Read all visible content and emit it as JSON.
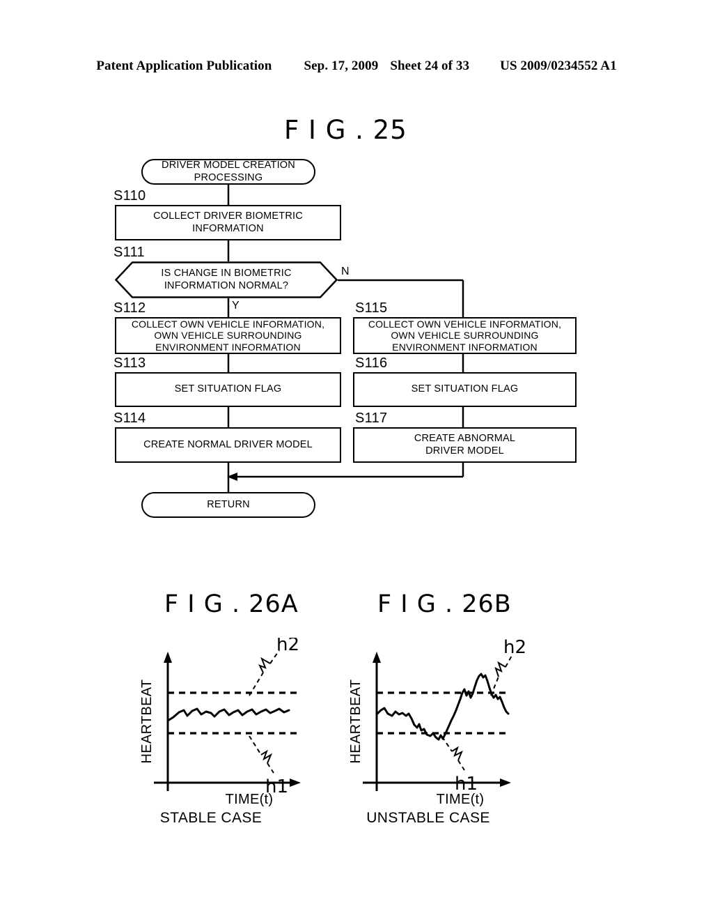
{
  "header": {
    "publication": "Patent Application Publication",
    "date": "Sep. 17, 2009",
    "sheet": "Sheet 24 of 33",
    "patent_number": "US 2009/0234552 A1"
  },
  "figures": {
    "fig25": {
      "title": "F I G . 25",
      "nodes": {
        "start": "DRIVER MODEL CREATION\nPROCESSING",
        "s110_box": "COLLECT DRIVER BIOMETRIC\nINFORMATION",
        "s111_decision": "IS CHANGE IN BIOMETRIC\nINFORMATION NORMAL?",
        "s112_box": "COLLECT OWN VEHICLE INFORMATION,\nOWN VEHICLE SURROUNDING\nENVIRONMENT INFORMATION",
        "s113_box": "SET SITUATION FLAG",
        "s114_box": "CREATE NORMAL DRIVER MODEL",
        "s115_box": "COLLECT OWN VEHICLE INFORMATION,\nOWN VEHICLE SURROUNDING\nENVIRONMENT INFORMATION",
        "s116_box": "SET SITUATION FLAG",
        "s117_box": "CREATE ABNORMAL\nDRIVER MODEL",
        "end": "RETURN"
      },
      "step_labels": {
        "s110": "S110",
        "s111": "S111",
        "s112": "S112",
        "s113": "S113",
        "s114": "S114",
        "s115": "S115",
        "s116": "S116",
        "s117": "S117"
      },
      "branch_labels": {
        "yes": "Y",
        "no": "N"
      }
    },
    "fig26a": {
      "title": "F I G . 26A",
      "caption": "STABLE CASE"
    },
    "fig26b": {
      "title": "F I G . 26B",
      "caption": "UNSTABLE CASE"
    }
  },
  "chart_data": [
    {
      "type": "line",
      "title": "F I G . 26A",
      "subtitle": "STABLE CASE",
      "xlabel": "TIME(t)",
      "ylabel": "HEARTBEAT",
      "grid": false,
      "legend": "none",
      "axis_ticks": [],
      "annotations": [
        {
          "label": "h2",
          "kind": "upper-threshold-callout"
        },
        {
          "label": "h1",
          "kind": "lower-threshold-callout"
        }
      ],
      "thresholds": [
        {
          "name": "h2",
          "value": 0.72,
          "style": "dashed"
        },
        {
          "name": "h1",
          "value": 0.28,
          "style": "dashed"
        }
      ],
      "series": [
        {
          "name": "heartbeat",
          "x": [
            0,
            0.04,
            0.09,
            0.13,
            0.16,
            0.2,
            0.24,
            0.27,
            0.31,
            0.35,
            0.38,
            0.42,
            0.46,
            0.5,
            0.54,
            0.57,
            0.61,
            0.65,
            0.69,
            0.73,
            0.77,
            0.81,
            0.85,
            0.89,
            0.93,
            0.97,
            1.0
          ],
          "y": [
            0.41,
            0.46,
            0.52,
            0.54,
            0.48,
            0.53,
            0.55,
            0.49,
            0.52,
            0.5,
            0.47,
            0.52,
            0.54,
            0.48,
            0.51,
            0.53,
            0.48,
            0.52,
            0.54,
            0.49,
            0.52,
            0.54,
            0.5,
            0.53,
            0.55,
            0.51,
            0.53
          ]
        }
      ],
      "ylim": [
        0,
        1
      ],
      "xlim": [
        0,
        1
      ]
    },
    {
      "type": "line",
      "title": "F I G . 26B",
      "subtitle": "UNSTABLE CASE",
      "xlabel": "TIME(t)",
      "ylabel": "HEARTBEAT",
      "grid": false,
      "legend": "none",
      "axis_ticks": [],
      "annotations": [
        {
          "label": "h2",
          "kind": "upper-threshold-callout"
        },
        {
          "label": "h1",
          "kind": "lower-threshold-callout"
        }
      ],
      "thresholds": [
        {
          "name": "h2",
          "value": 0.72,
          "style": "dashed"
        },
        {
          "name": "h1",
          "value": 0.28,
          "style": "dashed"
        }
      ],
      "series": [
        {
          "name": "heartbeat",
          "x": [
            0,
            0.03,
            0.06,
            0.09,
            0.12,
            0.15,
            0.18,
            0.21,
            0.24,
            0.27,
            0.3,
            0.33,
            0.36,
            0.39,
            0.42,
            0.45,
            0.48,
            0.51,
            0.54,
            0.57,
            0.6,
            0.63,
            0.66,
            0.69,
            0.72,
            0.75,
            0.78,
            0.81,
            0.84,
            0.87,
            0.9,
            0.93,
            0.96,
            1.0
          ],
          "y": [
            0.47,
            0.52,
            0.46,
            0.44,
            0.48,
            0.45,
            0.47,
            0.43,
            0.36,
            0.34,
            0.3,
            0.31,
            0.27,
            0.25,
            0.3,
            0.28,
            0.36,
            0.44,
            0.53,
            0.62,
            0.7,
            0.73,
            0.68,
            0.75,
            0.79,
            0.88,
            0.89,
            0.85,
            0.73,
            0.68,
            0.7,
            0.67,
            0.58,
            0.53
          ]
        }
      ],
      "ylim": [
        0,
        1
      ],
      "xlim": [
        0,
        1
      ]
    }
  ]
}
